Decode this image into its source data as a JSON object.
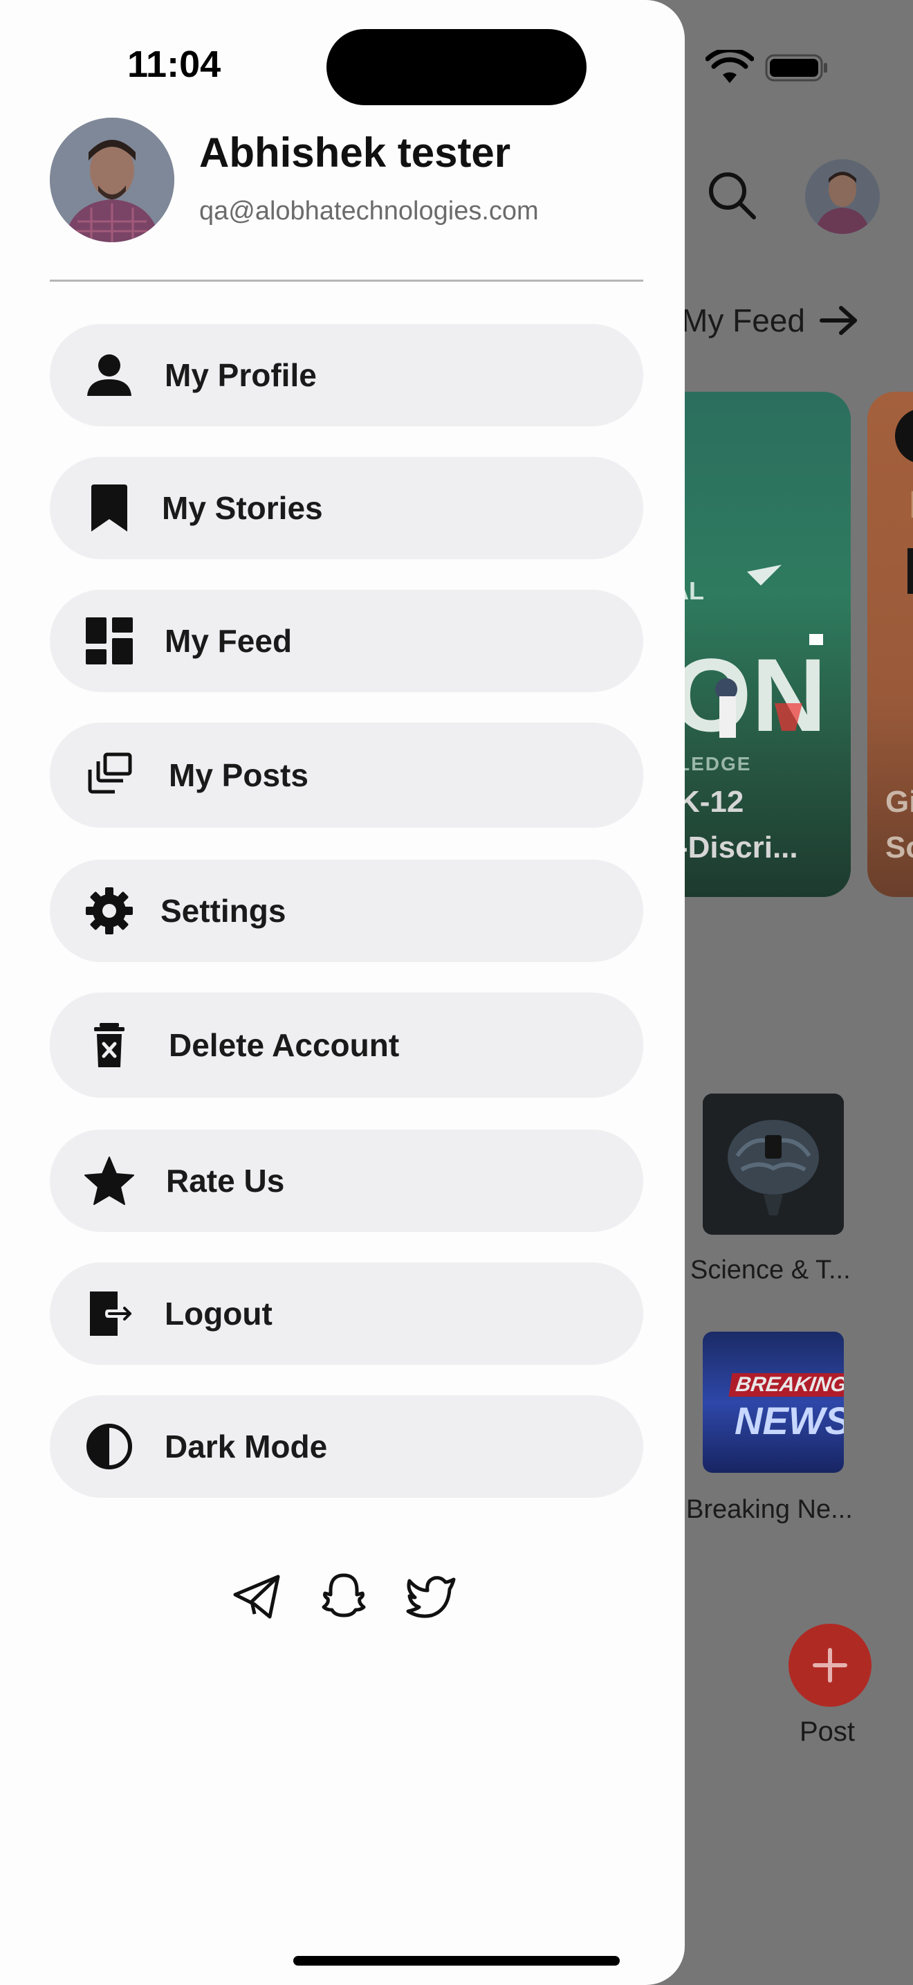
{
  "status_bar": {
    "time": "11:04"
  },
  "profile": {
    "name": "Abhishek tester",
    "email": "qa@alobhatechnologies.com"
  },
  "menu": {
    "items": [
      {
        "label": "My Profile",
        "icon": "person-icon"
      },
      {
        "label": "My Stories",
        "icon": "bookmark-icon"
      },
      {
        "label": "My Feed",
        "icon": "dashboard-icon"
      },
      {
        "label": "My Posts",
        "icon": "posts-stack-icon"
      },
      {
        "label": "Settings",
        "icon": "gear-icon"
      },
      {
        "label": "Delete Account",
        "icon": "trash-icon"
      },
      {
        "label": "Rate Us",
        "icon": "star-icon"
      },
      {
        "label": "Logout",
        "icon": "logout-icon"
      },
      {
        "label": "Dark Mode",
        "icon": "contrast-icon"
      }
    ]
  },
  "social": {
    "icons": [
      "telegram-icon",
      "snapchat-icon",
      "twitter-icon"
    ]
  },
  "background": {
    "my_feed_link": "My Feed",
    "card_1_tag": "LEDGE",
    "card_1_caption": "K-12\n-Discri...",
    "card_2_caption": "Gi\nSo",
    "card_2_title": "L",
    "categories": [
      {
        "label": "Science & T..."
      },
      {
        "label": "Breaking Ne..."
      }
    ],
    "news_tile_top": "BREAKING",
    "news_tile_bottom": "NEWS",
    "post_label": "Post"
  },
  "colors": {
    "overlay_bg": "#767676",
    "drawer_bg": "#fdfdfd",
    "menu_item_bg": "#efeff1",
    "fab": "#b02a24",
    "card_1": "#2e7b5f",
    "card_2": "#a4603c"
  }
}
